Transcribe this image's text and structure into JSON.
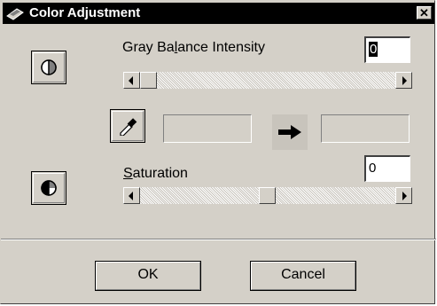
{
  "window": {
    "title": "Color Adjustment",
    "close_icon": "close-x-icon",
    "title_icon": "scanner-icon"
  },
  "gray_balance": {
    "label_pre": "Gray Ba",
    "label_mnemonic": "l",
    "label_post": "ance Intensity",
    "value": "0",
    "slider_position_fraction": 0.0
  },
  "color_sample": {
    "eyedropper_icon": "eyedropper-icon",
    "arrow_icon": "right-arrow-icon",
    "source_swatch": "",
    "target_swatch": ""
  },
  "saturation": {
    "label_mnemonic": "S",
    "label_post": "aturation",
    "value": "0",
    "slider_position_fraction": 0.5
  },
  "icons": {
    "gray_balance_icon": "half-circle-icon",
    "saturation_icon": "half-circle-saturation-icon"
  },
  "buttons": {
    "ok": "OK",
    "cancel": "Cancel"
  }
}
